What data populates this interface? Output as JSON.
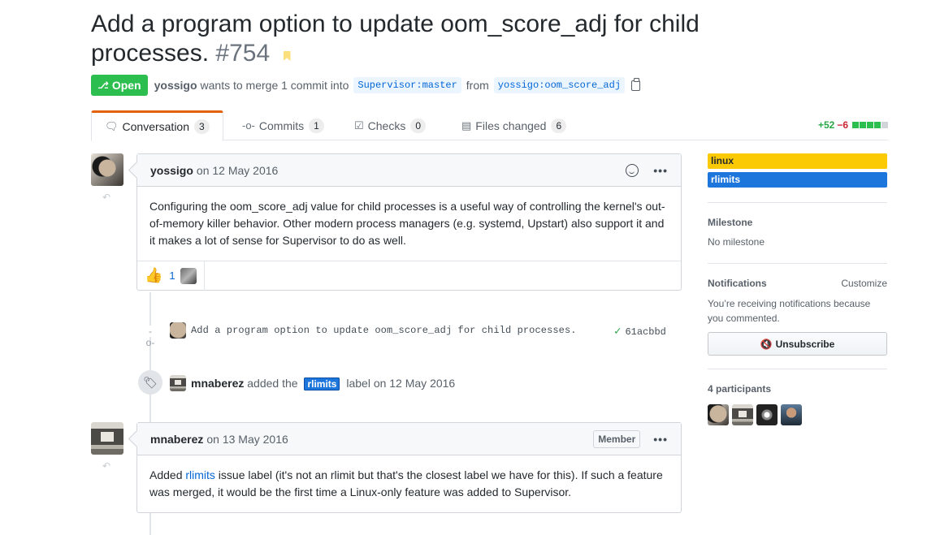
{
  "pr": {
    "title": "Add a program option to update oom_score_adj for child processes.",
    "number": "#754",
    "state": "Open",
    "author": "yossigo",
    "merge_text": "wants to merge 1 commit into",
    "base_branch": "Supervisor:master",
    "from_text": "from",
    "head_branch": "yossigo:oom_score_adj"
  },
  "tabs": [
    {
      "label": "Conversation",
      "count": "3",
      "icon": "comment-discussion-icon"
    },
    {
      "label": "Commits",
      "count": "1",
      "icon": "git-commit-icon"
    },
    {
      "label": "Checks",
      "count": "0",
      "icon": "checklist-icon"
    },
    {
      "label": "Files changed",
      "count": "6",
      "icon": "file-diff-icon"
    }
  ],
  "diffstat": {
    "additions": "+52",
    "deletions": "−6"
  },
  "comments": [
    {
      "author": "yossigo",
      "date": "on 12 May 2016",
      "body": "Configuring the oom_score_adj value for child processes is a useful way of controlling the kernel's out-of-memory killer behavior. Other modern process managers (e.g. systemd, Upstart) also support it and it makes a lot of sense for Supervisor to do as well.",
      "reaction_count": "1"
    },
    {
      "author": "mnaberez",
      "date": "on 13 May 2016",
      "badge": "Member",
      "body_pre": "Added ",
      "body_link": "rlimits",
      "body_post": " issue label (it's not an rlimit but that's the closest label we have for this). If such a feature was merged, it would be the first time a Linux-only feature was added to Supervisor."
    }
  ],
  "commit_event": {
    "message": "Add a program option to update oom_score_adj for child processes.",
    "sha": "61acbbd"
  },
  "label_event": {
    "actor": "mnaberez",
    "action": "added the",
    "label": "rlimits",
    "suffix": "label on 12 May 2016"
  },
  "sidebar": {
    "labels": [
      {
        "name": "linux",
        "color": "#fbca04",
        "text_color": "#24292e"
      },
      {
        "name": "rlimits",
        "color": "#1d76db",
        "text_color": "#ffffff"
      }
    ],
    "milestone_heading": "Milestone",
    "milestone_value": "No milestone",
    "notifications_heading": "Notifications",
    "customize": "Customize",
    "notifications_text": "You’re receiving notifications because you commented.",
    "unsubscribe": "Unsubscribe",
    "participants_heading": "4 participants"
  }
}
